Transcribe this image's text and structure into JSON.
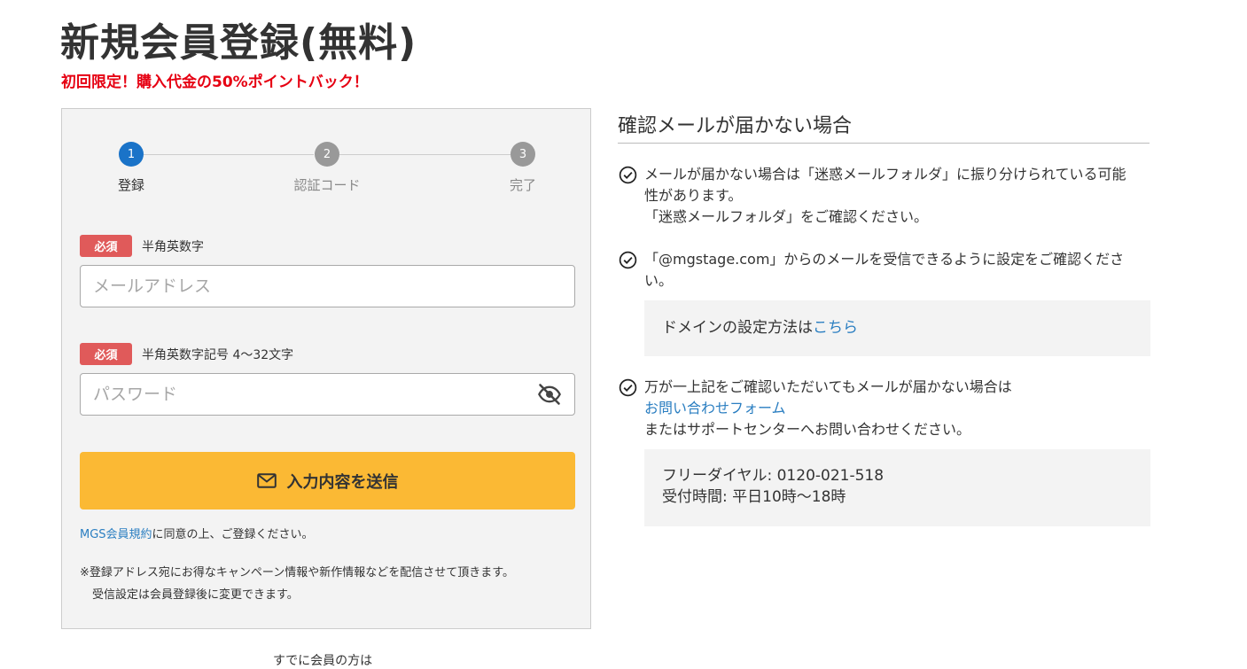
{
  "header": {
    "title": "新規会員登録(無料)",
    "promo": "初回限定！購入代金の50%ポイントバック！"
  },
  "steps": [
    {
      "number": "1",
      "label": "登録",
      "active": true
    },
    {
      "number": "2",
      "label": "認証コード",
      "active": false
    },
    {
      "number": "3",
      "label": "完了",
      "active": false
    }
  ],
  "form": {
    "required_label": "必須",
    "email_hint": "半角英数字",
    "email_placeholder": "メールアドレス",
    "password_hint": "半角英数字記号 4～32文字",
    "password_placeholder": "パスワード",
    "submit_label": "入力内容を送信",
    "terms_link": "MGS会員規約",
    "terms_suffix": "に同意の上、ご登録ください。",
    "notice_line1": "※登録アドレス宛にお得なキャンペーン情報や新作情報などを配信させて頂きます。",
    "notice_line2": "受信設定は会員登録後に変更できます。",
    "already_member": "すでに会員の方は"
  },
  "help": {
    "title": "確認メールが届かない場合",
    "item1_line1": "メールが届かない場合は「迷惑メールフォルダ」に振り分けられている可能",
    "item1_line2": "性があります。",
    "item1_line3": "「迷惑メールフォルダ」をご確認ください。",
    "item2_line1": "「@mgstage.com」からのメールを受信できるように設定をご確認くださ",
    "item2_line2": "い。",
    "domain_prefix": "ドメインの設定方法は",
    "domain_link": "こちら",
    "item3_line1": "万が一上記をご確認いただいてもメールが届かない場合は",
    "item3_link": "お問い合わせフォーム",
    "item3_line3": "またはサポートセンターへお問い合わせください。",
    "freedial": "フリーダイヤル: 0120-021-518",
    "hours": "受付時間: 平日10時～18時"
  },
  "icons": {
    "step_active": "#1a73c8",
    "badge": "#e05a5a",
    "button": "#fbb934",
    "promo": "#e60012",
    "link": "#2a7ec1",
    "names": [
      "mail-icon",
      "eye-off-icon",
      "check-circle-icon"
    ]
  }
}
